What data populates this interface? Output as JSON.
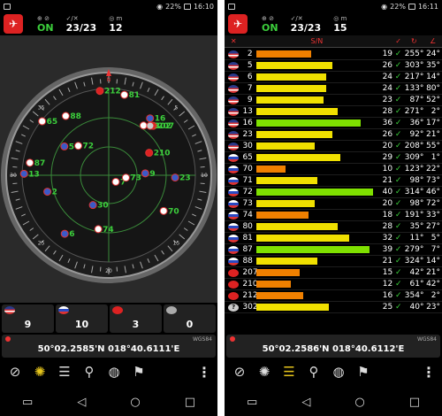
{
  "colors": {
    "fix_on": "#3ccf3c",
    "bar_green": "#7fe000",
    "bar_yellow": "#f0e000",
    "bar_orange": "#f08000",
    "accent_red": "#e33"
  },
  "left": {
    "status": {
      "battery": "22%",
      "time": "16:10"
    },
    "top": {
      "fix_label": "ON",
      "sats": "23/23",
      "accuracy": "12"
    },
    "radar": {
      "compass_labels": [
        "N",
        "5",
        "10",
        "15",
        "20",
        "25",
        "30",
        "35"
      ],
      "sats": [
        {
          "prn": "74",
          "flag": "ru"
        },
        {
          "prn": "6",
          "flag": "us"
        },
        {
          "prn": "30",
          "flag": "us"
        },
        {
          "prn": "2",
          "flag": "us"
        },
        {
          "prn": "70",
          "flag": "ru"
        },
        {
          "prn": "7",
          "flag": "ru"
        },
        {
          "prn": "73",
          "flag": "ru"
        },
        {
          "prn": "9",
          "flag": "us"
        },
        {
          "prn": "23",
          "flag": "us"
        },
        {
          "prn": "5",
          "flag": "us"
        },
        {
          "prn": "72",
          "flag": "ru"
        },
        {
          "prn": "13",
          "flag": "us"
        },
        {
          "prn": "65",
          "flag": "ru"
        },
        {
          "prn": "88",
          "flag": "ru"
        },
        {
          "prn": "210",
          "flag": "cn"
        },
        {
          "prn": "80",
          "flag": "ru"
        },
        {
          "prn": "16",
          "flag": "us"
        },
        {
          "prn": "207",
          "flag": "cn"
        },
        {
          "prn": "81",
          "flag": "ru"
        },
        {
          "prn": "87",
          "flag": "ru"
        },
        {
          "prn": "212",
          "flag": "cn"
        },
        {
          "prn": "302",
          "flag": "q"
        }
      ]
    },
    "counts": [
      {
        "flag": "us",
        "value": "9"
      },
      {
        "flag": "ru",
        "value": "10"
      },
      {
        "flag": "cn",
        "value": "3"
      },
      {
        "flag": "q",
        "value": "0"
      }
    ],
    "coord": {
      "datum": "WGS84",
      "text": "50°02.2585'N  018°40.6111'E"
    },
    "tools": [
      "compass-icon",
      "radar-icon",
      "list-icon",
      "walk-icon",
      "globe-icon",
      "pin-icon",
      "menu-icon"
    ]
  },
  "right": {
    "status": {
      "battery": "22%",
      "time": "16:11"
    },
    "top": {
      "fix_label": "ON",
      "sats": "23/23",
      "accuracy": "15"
    },
    "header": {
      "snr_label": "S/N"
    },
    "coord": {
      "datum": "WGS84",
      "text": "50°02.2586'N  018°40.6112'E"
    },
    "rows": [
      {
        "flag": "us",
        "prn": "2",
        "snr": 19,
        "used": "✓",
        "az": "255°",
        "el": "24°"
      },
      {
        "flag": "us",
        "prn": "5",
        "snr": 26,
        "used": "✓",
        "az": "303°",
        "el": "35°"
      },
      {
        "flag": "us",
        "prn": "6",
        "snr": 24,
        "used": "✓",
        "az": "217°",
        "el": "14°"
      },
      {
        "flag": "us",
        "prn": "7",
        "snr": 24,
        "used": "✓",
        "az": "133°",
        "el": "80°"
      },
      {
        "flag": "us",
        "prn": "9",
        "snr": 23,
        "used": "✓",
        "az": "87°",
        "el": "52°"
      },
      {
        "flag": "us",
        "prn": "13",
        "snr": 28,
        "used": "✓",
        "az": "271°",
        "el": "2°"
      },
      {
        "flag": "us",
        "prn": "16",
        "snr": 36,
        "used": "✓",
        "az": "36°",
        "el": "17°"
      },
      {
        "flag": "us",
        "prn": "23",
        "snr": 26,
        "used": "✓",
        "az": "92°",
        "el": "21°"
      },
      {
        "flag": "us",
        "prn": "30",
        "snr": 20,
        "used": "✓",
        "az": "208°",
        "el": "55°"
      },
      {
        "flag": "ru",
        "prn": "65",
        "snr": 29,
        "used": "✓",
        "az": "309°",
        "el": "1°"
      },
      {
        "flag": "ru",
        "prn": "70",
        "snr": 10,
        "used": "✓",
        "az": "123°",
        "el": "22°"
      },
      {
        "flag": "ru",
        "prn": "71",
        "snr": 21,
        "used": "✓",
        "az": "98°",
        "el": "73°"
      },
      {
        "flag": "ru",
        "prn": "72",
        "snr": 40,
        "used": "✓",
        "az": "314°",
        "el": "46°"
      },
      {
        "flag": "ru",
        "prn": "73",
        "snr": 20,
        "used": "✓",
        "az": "98°",
        "el": "72°"
      },
      {
        "flag": "ru",
        "prn": "74",
        "snr": 18,
        "used": "✓",
        "az": "191°",
        "el": "33°"
      },
      {
        "flag": "ru",
        "prn": "80",
        "snr": 28,
        "used": "✓",
        "az": "35°",
        "el": "27°"
      },
      {
        "flag": "ru",
        "prn": "81",
        "snr": 32,
        "used": "✓",
        "az": "11°",
        "el": "5°"
      },
      {
        "flag": "ru",
        "prn": "87",
        "snr": 39,
        "used": "✓",
        "az": "279°",
        "el": "7°"
      },
      {
        "flag": "ru",
        "prn": "88",
        "snr": 21,
        "used": "✓",
        "az": "324°",
        "el": "14°"
      },
      {
        "flag": "cn",
        "prn": "207",
        "snr": 15,
        "used": "✓",
        "az": "42°",
        "el": "21°"
      },
      {
        "flag": "cn",
        "prn": "210",
        "snr": 12,
        "used": "✓",
        "az": "61°",
        "el": "42°"
      },
      {
        "flag": "cn",
        "prn": "212",
        "snr": 16,
        "used": "✓",
        "az": "354°",
        "el": "2°"
      },
      {
        "flag": "q",
        "prn": "302",
        "snr": 25,
        "used": "✓",
        "az": "40°",
        "el": "23°"
      }
    ]
  }
}
